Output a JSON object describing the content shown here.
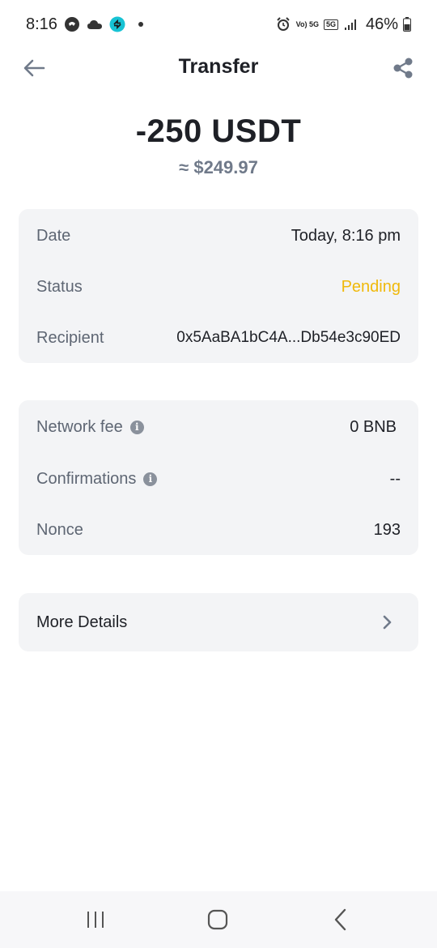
{
  "status_bar": {
    "time": "8:16",
    "network_badge": "5G",
    "volte_badge": "Vo) 5G",
    "battery": "46%"
  },
  "header": {
    "title": "Transfer"
  },
  "amount": {
    "value": "-250 USDT",
    "fiat": "≈ $249.97"
  },
  "details_card": {
    "rows": [
      {
        "label": "Date",
        "value": "Today, 8:16 pm"
      },
      {
        "label": "Status",
        "value": "Pending"
      },
      {
        "label": "Recipient",
        "value": "0x5AaBA1bC4A...Db54e3c90ED"
      }
    ]
  },
  "fee_card": {
    "rows": [
      {
        "label": "Network fee",
        "value": "0 BNB"
      },
      {
        "label": "Confirmations",
        "value": "--"
      },
      {
        "label": "Nonce",
        "value": "193"
      }
    ]
  },
  "more_details": {
    "label": "More Details"
  },
  "colors": {
    "pending": "#f0b90b",
    "card_bg": "#f3f4f6",
    "label": "#5e6673",
    "text": "#1e2026"
  }
}
